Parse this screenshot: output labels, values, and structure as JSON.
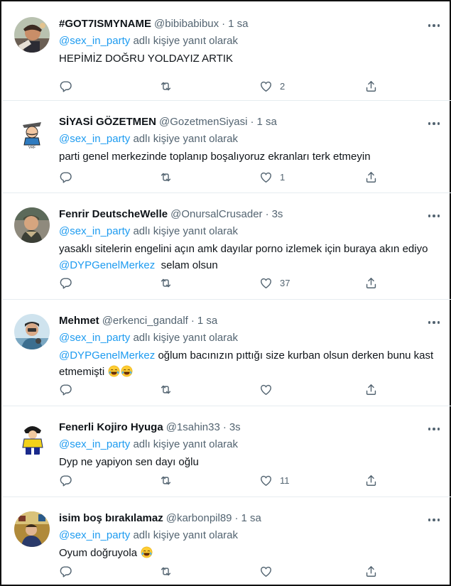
{
  "colors": {
    "accent": "#1d9bf0",
    "text": "#0f1419",
    "muted": "#536471",
    "divider": "#e6ecf0"
  },
  "icons": {
    "reply": "reply-icon",
    "retweet": "retweet-icon",
    "like": "heart-icon",
    "share": "share-icon",
    "more": "more-icon",
    "emoji": "tears-of-joy-emoji"
  },
  "tweets": [
    {
      "name": "#GOT7ISMYNAME",
      "handle": "@bibibabibux",
      "dot": "·",
      "time": "1 sa",
      "reply_mention": "@sex_in_party",
      "reply_suffix": " adlı kişiye yanıt olarak",
      "text": "HEPİMİZ DOĞRU YOLDAYIZ ARTIK",
      "likes": "2"
    },
    {
      "name": "SİYASİ GÖZETMEN",
      "handle": "@GozetmenSiyasi",
      "dot": "·",
      "time": "1 sa",
      "reply_mention": "@sex_in_party",
      "reply_suffix": " adlı kişiye yanıt olarak",
      "text": "parti genel merkezinde toplanıp boşalıyoruz ekranları terk etmeyin",
      "likes": "1"
    },
    {
      "name": "Fenrir DeutscheWelle",
      "handle": "@OnursalCrusader",
      "dot": "·",
      "time": "3s",
      "reply_mention": "@sex_in_party",
      "reply_suffix": " adlı kişiye yanıt olarak",
      "text_a": "yasaklı sitelerin engelini açın amk dayılar porno izlemek için buraya akın ediyo ",
      "text_mention": "@DYPGenelMerkez",
      "text_b": "  selam olsun",
      "likes": "37"
    },
    {
      "name": "Mehmet",
      "handle": "@erkenci_gandalf",
      "dot": "·",
      "time": "1 sa",
      "reply_mention": "@sex_in_party",
      "reply_suffix": " adlı kişiye yanıt olarak",
      "text_mention": "@DYPGenelMerkez",
      "text_b": " oğlum bacınızın pıttığı size kurban olsun derken bunu kast etmemişti ",
      "likes": ""
    },
    {
      "name": "Fenerli Kojiro Hyuga",
      "handle": "@1sahin33",
      "dot": "·",
      "time": "3s",
      "reply_mention": "@sex_in_party",
      "reply_suffix": " adlı kişiye yanıt olarak",
      "text": "Dyp ne yapiyon sen dayı oğlu",
      "likes": "11"
    },
    {
      "name": "isim boş bırakılamaz",
      "handle": "@karbonpil89",
      "dot": "·",
      "time": "1 sa",
      "reply_mention": "@sex_in_party",
      "reply_suffix": " adlı kişiye yanıt olarak",
      "text": "Oyum doğruyola ",
      "likes": ""
    }
  ]
}
